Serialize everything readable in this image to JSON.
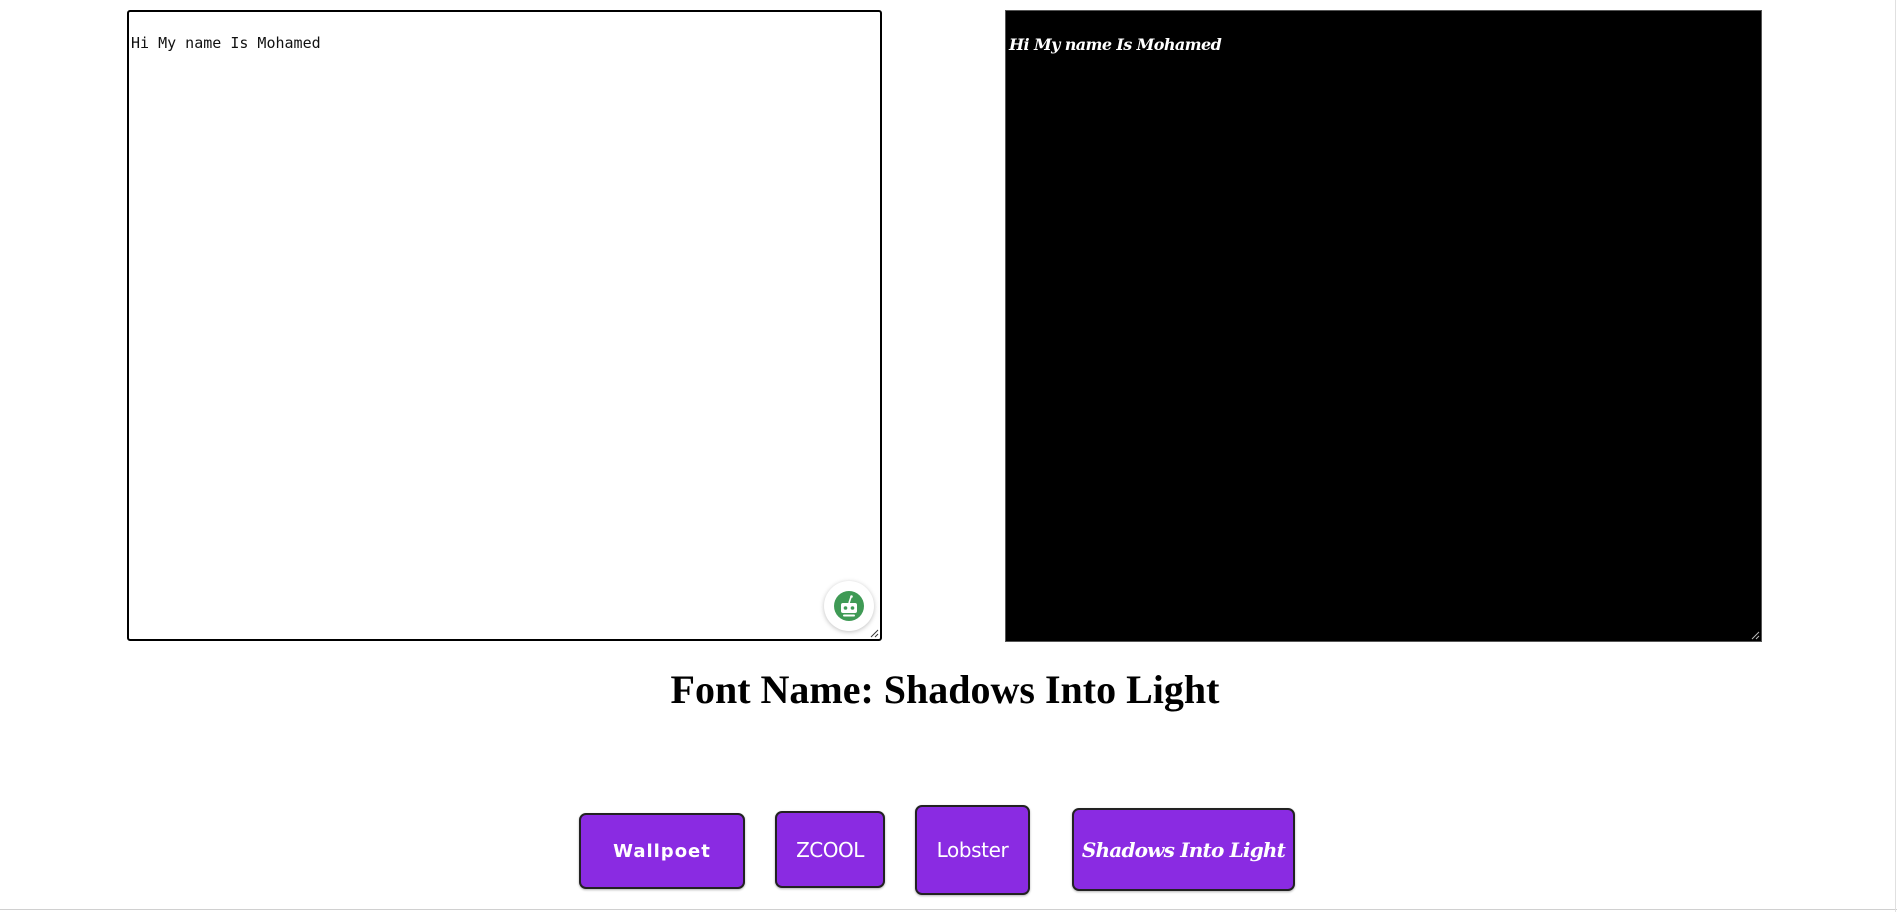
{
  "editor": {
    "value": "Hi My name Is Mohamed"
  },
  "preview": {
    "text": "Hi My name Is Mohamed"
  },
  "font_title": "Font Name: Shadows Into Light",
  "font_buttons": [
    {
      "label": "Wallpoet"
    },
    {
      "label": "ZCOOL"
    },
    {
      "label": "Lobster"
    },
    {
      "label": "Shadows Into Light"
    }
  ],
  "colors": {
    "button_bg": "#8a2be2",
    "preview_bg": "#000000",
    "assistant_icon": "#3f9a55"
  },
  "icons": {
    "assistant": "robot-assistant-icon",
    "resize": "resize-grip-icon"
  }
}
